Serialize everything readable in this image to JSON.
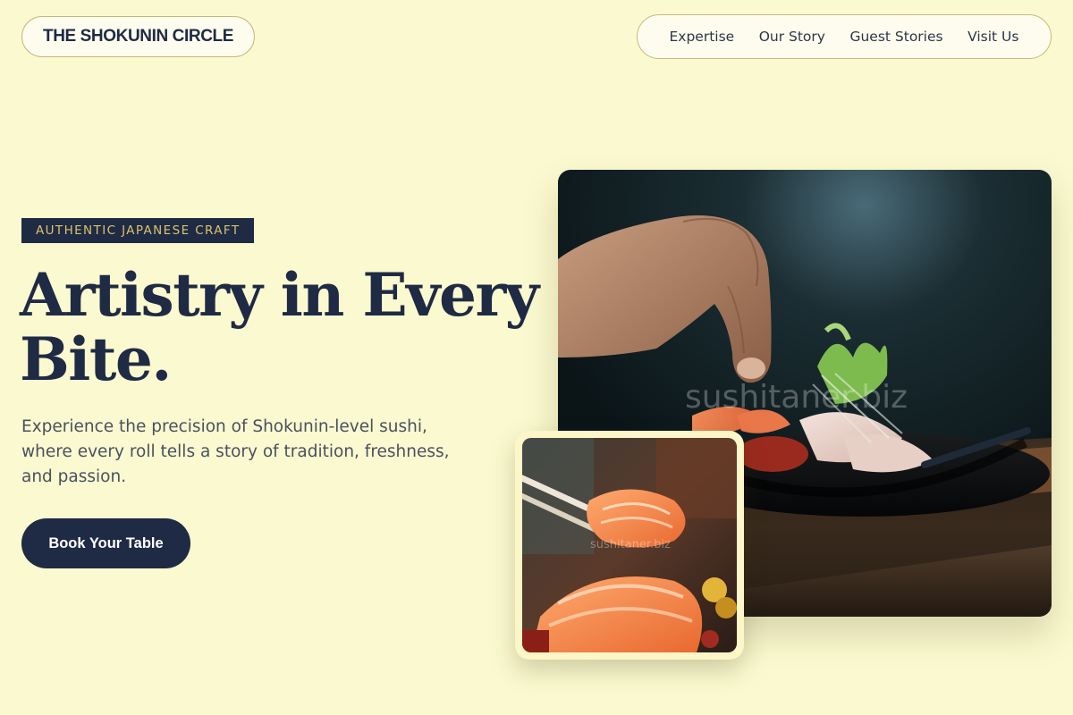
{
  "brand": {
    "name": "THE SHOKUNIN CIRCLE"
  },
  "nav": {
    "items": [
      {
        "label": "Expertise"
      },
      {
        "label": "Our Story"
      },
      {
        "label": "Guest Stories"
      },
      {
        "label": "Visit Us"
      }
    ]
  },
  "hero": {
    "eyebrow": "AUTHENTIC JAPANESE CRAFT",
    "headline_line1": "Artistry in Every",
    "headline_line2": "Bite.",
    "subtext": "Experience the precision of Shokunin-level sushi, where every roll tells a story of tradition, freshness, and passion.",
    "cta_label": "Book Your Table"
  },
  "images": {
    "main_watermark": "sushitaner.biz",
    "inset_watermark": "sushitaner.biz"
  },
  "colors": {
    "background": "#fbf9cf",
    "navy": "#1f2a44",
    "gold": "#d9c36b",
    "border": "#c9b87a"
  }
}
